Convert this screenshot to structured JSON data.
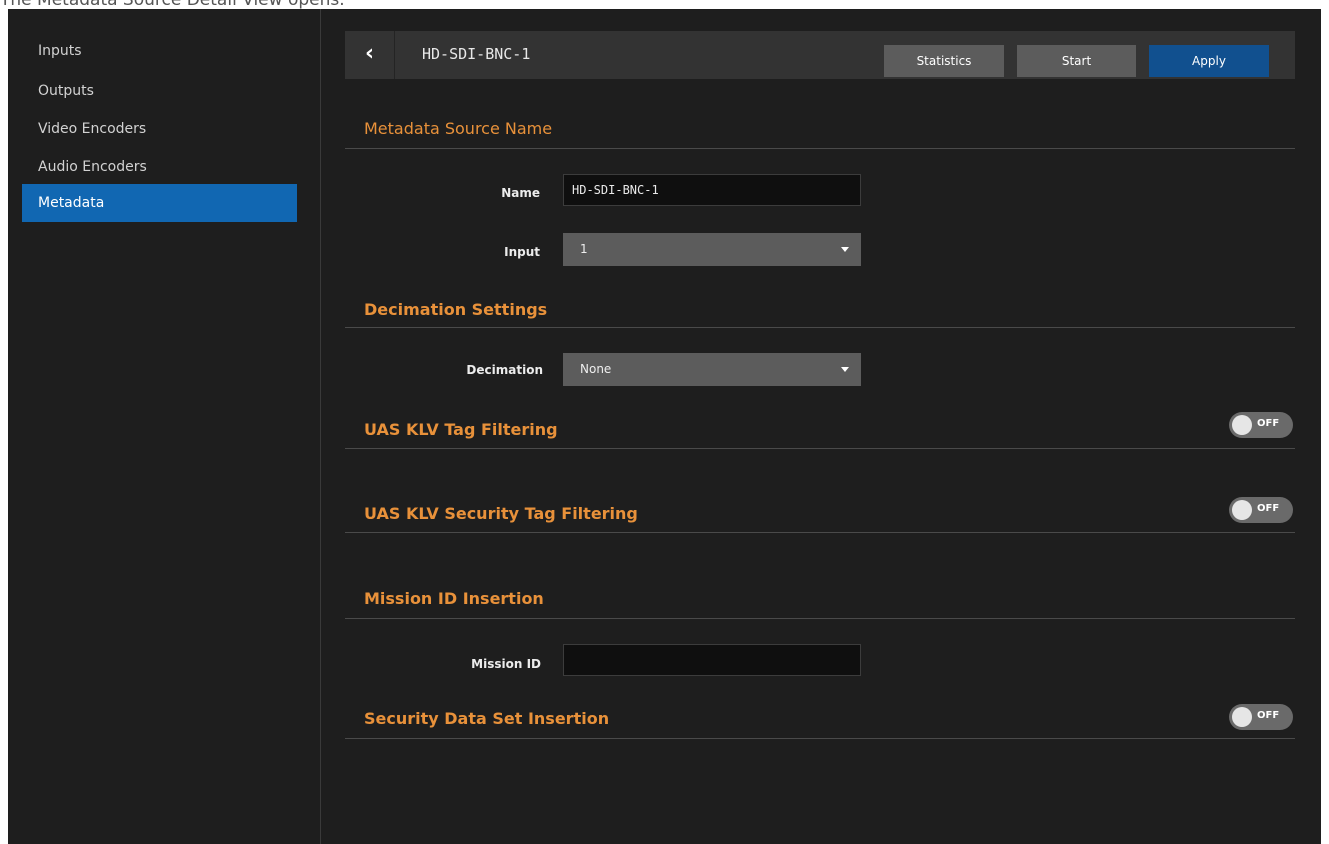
{
  "caption": "The Metadata Source Detail View opens.",
  "sidebar": {
    "items": [
      {
        "label": "Inputs",
        "active": false
      },
      {
        "label": "Outputs",
        "active": false
      },
      {
        "label": "Video Encoders",
        "active": false
      },
      {
        "label": "Audio Encoders",
        "active": false
      },
      {
        "label": "Metadata",
        "active": true
      }
    ]
  },
  "header": {
    "back_icon": "chevron-left-icon",
    "title": "HD-SDI-BNC-1",
    "statistics_label": "Statistics",
    "start_label": "Start",
    "apply_label": "Apply"
  },
  "sections": {
    "source_name": {
      "title": "Metadata Source Name",
      "name_label": "Name",
      "name_value": "HD-SDI-BNC-1",
      "input_label": "Input",
      "input_value": "1"
    },
    "decimation": {
      "title": "Decimation Settings",
      "decimation_label": "Decimation",
      "decimation_value": "None"
    },
    "tag_filtering": {
      "title": "UAS KLV Tag Filtering",
      "toggle_label": "OFF"
    },
    "security_tag_filtering": {
      "title": "UAS KLV Security Tag Filtering",
      "toggle_label": "OFF"
    },
    "mission_id": {
      "title": "Mission ID Insertion",
      "mission_id_label": "Mission ID",
      "mission_id_value": ""
    },
    "security_data_set": {
      "title": "Security Data Set Insertion",
      "toggle_label": "OFF"
    }
  },
  "colors": {
    "accent_orange": "#e8913a",
    "active_nav": "#1167b2",
    "apply_blue": "#11508f",
    "background": "#1e1e1e"
  }
}
